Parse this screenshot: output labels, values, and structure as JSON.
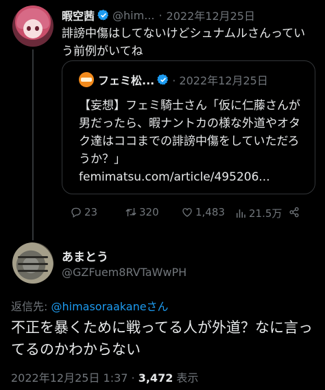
{
  "tweet1": {
    "author_name": "暇空茜",
    "author_handle": "@him...",
    "separator": "·",
    "date": "2022年12月25日",
    "text": "誹謗中傷はしてないけどシュナムルさんっていう前例がいてね",
    "quote": {
      "author_name": "フェミ松...",
      "date": "· 2022年12月25日",
      "text": "【妄想】フェミ騎士さん「仮に仁藤さんが男だったら、暇ナントカの様な外道やオタク達はココまでの誹謗中傷をしていただろうか？」",
      "link": "femimatsu.com/article/495206..."
    },
    "actions": {
      "replies": "23",
      "retweets": "320",
      "likes": "1,483",
      "views": "21.5万"
    }
  },
  "tweet2": {
    "author_name": "あまとう",
    "author_handle": "@GZFuem8RVTaWwPH",
    "reply_to_label": "返信先: ",
    "reply_to_handle": "@himasoraakaneさん",
    "text": "不正を暴くために戦ってる人が外道？なに言ってるのかわからない",
    "meta_time": "2022年12月25日 1:37 · ",
    "meta_views": "3,472",
    "meta_views_label": " 表示"
  },
  "colors": {
    "background": "#000000",
    "text": "#e7e9ea",
    "muted": "#71767b",
    "link": "#1d9bf0",
    "border": "#333639",
    "verified": "#1d9bf0"
  }
}
